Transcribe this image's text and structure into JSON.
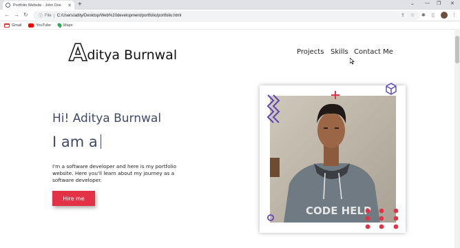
{
  "browser": {
    "tab_title": "Portfolio Website - John Doe",
    "new_tab": "+",
    "file_label": "File",
    "url": "C:/Users/adity/Desktop/Web%20development/portfolio/portfolio.html",
    "bookmarks": [
      {
        "label": "Gmail",
        "color": "#d93025"
      },
      {
        "label": "YouTube",
        "color": "#ff0000"
      },
      {
        "label": "Maps",
        "color": "#34a853"
      }
    ]
  },
  "header": {
    "logo_letter": "A",
    "logo_text": "ditya Burnwal",
    "nav": [
      {
        "label": "Projects"
      },
      {
        "label": "Skills"
      },
      {
        "label": "Contact Me"
      }
    ]
  },
  "hero": {
    "greeting": "Hi! Aditya Burnwal",
    "typed_text": "I am a",
    "description": "I'm a software developer and here is my portfolio website. Here you'll learn about my journey as a software developer.",
    "cta_label": "Hire me",
    "photo_caption": "CODE HELP"
  },
  "colors": {
    "accent": "#e33245",
    "heading": "#3f4a6b",
    "decor_purple": "#5b43b5"
  }
}
